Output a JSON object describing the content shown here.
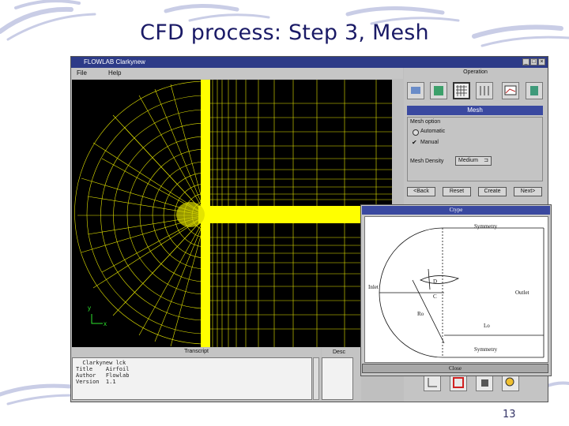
{
  "slide": {
    "title": "CFD process: Step 3, Mesh",
    "page_number": "13"
  },
  "window": {
    "title": "FLOWLAB Clarkynew",
    "buttons": [
      "_",
      "□",
      "×"
    ]
  },
  "menu": {
    "items": [
      "File",
      "Help"
    ]
  },
  "operation": {
    "label": "Operation",
    "tools": [
      "geometry-icon",
      "physics-icon",
      "mesh-icon",
      "solve-icon",
      "plot-icon",
      "report-icon"
    ],
    "selected": "mesh-icon"
  },
  "mesh_panel": {
    "title": "Mesh",
    "option_label": "Mesh option",
    "options": [
      "Automatic",
      "Manual"
    ],
    "selected_option": "Manual",
    "density_label": "Mesh Density",
    "density_value": "Medium",
    "buttons": {
      "back": "<Back",
      "reset": "Reset",
      "create": "Create",
      "next": "Next>"
    }
  },
  "axes": {
    "y": "y",
    "x": "x"
  },
  "transcript": {
    "label": "Transcript",
    "lines": [
      "  Clarkynew lck",
      "Title    Airfoil",
      "Author   Flowlab",
      "Version  1.1"
    ]
  },
  "description": {
    "label": "Desc"
  },
  "ctype_dialog": {
    "title": "Ctype",
    "labels": {
      "symmetry_top": "Symmetry",
      "symmetry_bottom": "Symmetry",
      "inlet": "Inlet",
      "outlet": "Outlet",
      "ro": "Ro",
      "lo": "Lo",
      "d": "D",
      "c": "C"
    },
    "close_label": "Close"
  },
  "colors": {
    "mesh": "#ffff00",
    "background": "#000000",
    "titlebar": "#2d3b88",
    "panel_header": "#3a49a0"
  }
}
